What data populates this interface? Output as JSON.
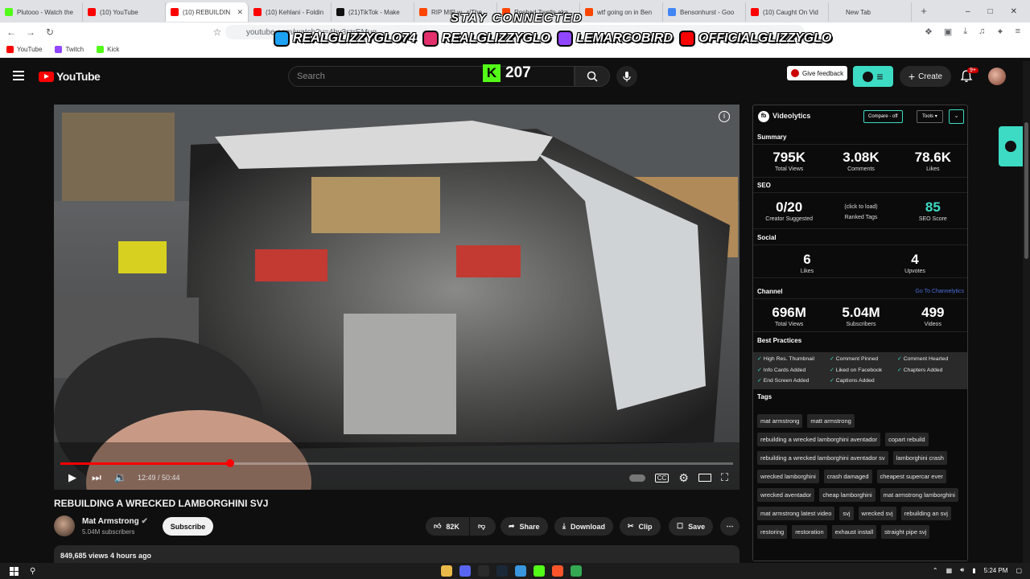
{
  "browser": {
    "tabs": [
      {
        "title": "Plutooo - Watch the",
        "color": "#53fc18",
        "active": false
      },
      {
        "title": "(10) YouTube",
        "color": "#ff0000",
        "active": false
      },
      {
        "title": "(10) REBUILDIN",
        "color": "#ff0000",
        "active": true
      },
      {
        "title": "(10) Kehlani - Foldin",
        "color": "#ff0000",
        "active": false
      },
      {
        "title": "(21)TikTok - Make",
        "color": "#111111",
        "active": false
      },
      {
        "title": "RIP MIR w...r/The",
        "color": "#ff4500",
        "active": false
      },
      {
        "title": "Roshad Twells aka",
        "color": "#ff4500",
        "active": false
      },
      {
        "title": "wtf going on in Ben",
        "color": "#ff4500",
        "active": false
      },
      {
        "title": "Bensonhurst - Goo",
        "color": "#4285f4",
        "active": false
      },
      {
        "title": "(10) Caught On Vid",
        "color": "#ff0000",
        "active": false
      },
      {
        "title": "New Tab",
        "color": "#dfe1e5",
        "active": false
      }
    ],
    "url": "youtube.com/watch?v=4bv3rzrEMuq",
    "bookmarks": [
      {
        "label": "YouTube",
        "color": "#ff0000"
      },
      {
        "label": "Twitch",
        "color": "#9146ff"
      },
      {
        "label": "Kick",
        "color": "#53fc18"
      }
    ]
  },
  "overlay": {
    "title": "STAY CONNECTED",
    "socials": [
      {
        "handle": "REALGLIZZYGLO74",
        "color": "#1da1f2",
        "icon": "twitter-icon"
      },
      {
        "handle": "REALGLIZZYGLO",
        "color": "#e1306c",
        "icon": "instagram-icon"
      },
      {
        "handle": "LEMARCOBIRD",
        "color": "#9146ff",
        "icon": "twitch-icon"
      },
      {
        "handle": "OFFICIALGLIZZYGLO",
        "color": "#ff0000",
        "icon": "youtube-icon"
      }
    ],
    "kick_count": "207"
  },
  "header": {
    "logo": "YouTube",
    "search_placeholder": "Search",
    "feedback": "Give feedback",
    "create": "Create",
    "notifications": "9+"
  },
  "video": {
    "time": "12:49 / 50:44",
    "progress": 0.2527,
    "title": "REBUILDING A WRECKED LAMBORGHINI SVJ",
    "channel": "Mat Armstrong",
    "subscribers": "5.04M subscribers",
    "subscribe": "Subscribe",
    "likes": "82K",
    "share": "Share",
    "download": "Download",
    "clip": "Clip",
    "save": "Save",
    "views_line": "849,685 views  4 hours ago"
  },
  "videolytics": {
    "brand": "Videolytics",
    "compare": "Compare - off",
    "tools": "Tools",
    "summary_label": "Summary",
    "summary": [
      {
        "value": "795K",
        "label": "Total Views"
      },
      {
        "value": "3.08K",
        "label": "Comments"
      },
      {
        "value": "78.6K",
        "label": "Likes"
      }
    ],
    "seo_label": "SEO",
    "seo": [
      {
        "value": "0/20",
        "label": "Creator Suggested"
      },
      {
        "value": "(click to load)",
        "label": "Ranked Tags"
      },
      {
        "value": "85",
        "label": "SEO Score"
      }
    ],
    "social_label": "Social",
    "social": [
      {
        "value": "6",
        "label": "Likes"
      },
      {
        "value": "4",
        "label": "Upvotes"
      }
    ],
    "channel_label": "Channel",
    "channel_link": "Go To Channelytics",
    "channel": [
      {
        "value": "696M",
        "label": "Total Views"
      },
      {
        "value": "5.04M",
        "label": "Subscribers"
      },
      {
        "value": "499",
        "label": "Videos"
      }
    ],
    "best_practices_label": "Best Practices",
    "best_practices": [
      "High Res. Thumbnail",
      "Comment Pinned",
      "Comment Hearted",
      "Info Cards Added",
      "Liked on Facebook",
      "Chapters Added",
      "End Screen Added",
      "Captions Added"
    ],
    "tags_label": "Tags",
    "tags": [
      "mat armstrong",
      "matt armstrong",
      "rebuilding a wrecked lamborghini aventador",
      "copart rebuild",
      "rebuilding a wrecked lamborghini aventador sv",
      "lamborghini crash",
      "wrecked lamborghini",
      "crash damaged",
      "cheapest supercar ever",
      "wrecked aventador",
      "cheap lamborghini",
      "mat armstrong lamborghini",
      "mat armstrong latest video",
      "svj",
      "wrecked svj",
      "rebuilding an svj",
      "restoring",
      "restoration",
      "exhaust install",
      "straight pipe svj"
    ]
  },
  "taskbar": {
    "clock": "5:24 PM",
    "apps": [
      "#e9b949",
      "#5865f2",
      "#2a2a2a",
      "#1b2838",
      "#3a96dd",
      "#53fc18",
      "#fb542b",
      "#34a853"
    ]
  }
}
